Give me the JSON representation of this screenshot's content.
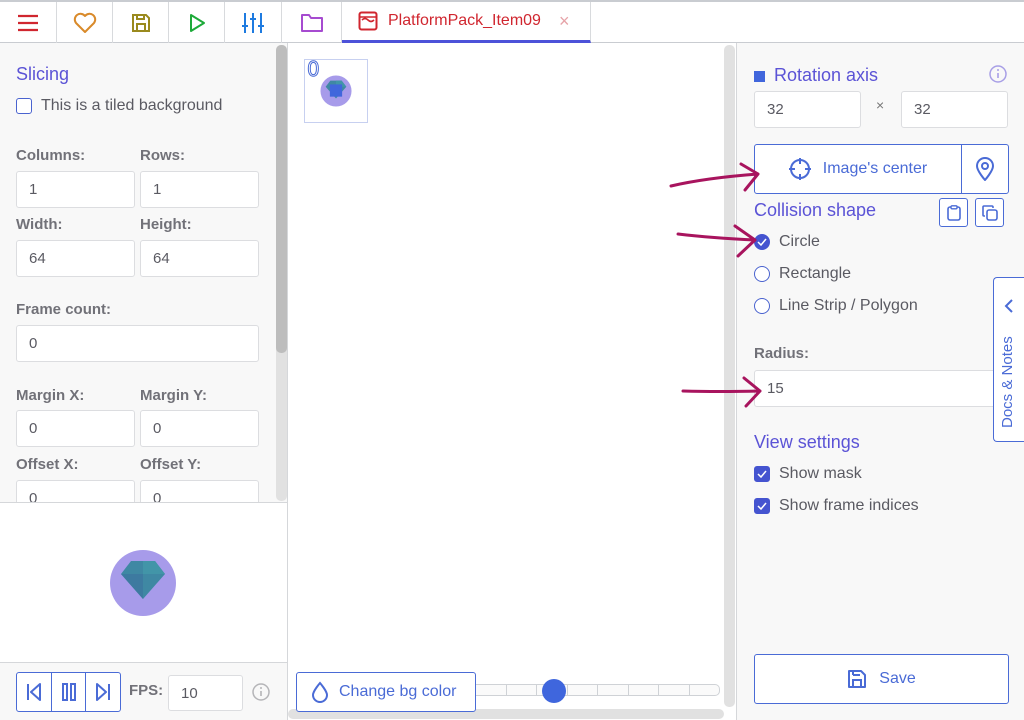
{
  "toolbar": {
    "buttons": [
      {
        "name": "menu",
        "icon": "hamburger-icon",
        "color": "#d0262f"
      },
      {
        "name": "favorites",
        "icon": "heart-icon",
        "color": "#d98a2a"
      },
      {
        "name": "save-project",
        "icon": "floppy-disk-icon",
        "color": "#9a8a1e"
      },
      {
        "name": "launch",
        "icon": "play-icon",
        "color": "#1eaa3a"
      },
      {
        "name": "settings",
        "icon": "sliders-icon",
        "color": "#1e7be0"
      },
      {
        "name": "assets",
        "icon": "folder-icon",
        "color": "#a64bd0"
      }
    ],
    "active_tab": {
      "label": "PlatformPack_Item09",
      "icon": "texture-icon",
      "close": "×"
    }
  },
  "left_panel": {
    "slicing_title": "Slicing",
    "tiled_checkbox": {
      "label": "This is a tiled background",
      "checked": false
    },
    "columns": {
      "label": "Columns:",
      "value": "1"
    },
    "rows": {
      "label": "Rows:",
      "value": "1"
    },
    "width": {
      "label": "Width:",
      "value": "64"
    },
    "height": {
      "label": "Height:",
      "value": "64"
    },
    "frame_count": {
      "label": "Frame count:",
      "value": "0"
    },
    "margin_x": {
      "label": "Margin X:",
      "value": "0"
    },
    "margin_y": {
      "label": "Margin Y:",
      "value": "0"
    },
    "offset_x": {
      "label": "Offset X:",
      "value": "0"
    },
    "offset_y": {
      "label": "Offset Y:",
      "value": "0"
    },
    "playback": {
      "first_frame": "skip-back-icon",
      "pause": "pause-icon",
      "last_frame": "skip-forward-icon",
      "fps_label": "FPS:",
      "fps_value": "10",
      "info": "info-icon"
    }
  },
  "canvas": {
    "frame_index": "0",
    "change_bg_label": "Change bg color",
    "zoom_slider_position": 0.25
  },
  "right_panel": {
    "rotation_axis_title": "Rotation axis",
    "axis_x": "32",
    "axis_sep": "×",
    "axis_y": "32",
    "image_center_label": "Image's center",
    "collision_title": "Collision shape",
    "shapes": [
      {
        "label": "Circle",
        "selected": true
      },
      {
        "label": "Rectangle",
        "selected": false
      },
      {
        "label": "Line Strip / Polygon",
        "selected": false
      }
    ],
    "radius_label": "Radius:",
    "radius_value": "15",
    "view_title": "View settings",
    "show_mask": {
      "label": "Show mask",
      "checked": true
    },
    "show_indices": {
      "label": "Show frame indices",
      "checked": true
    },
    "save_label": "Save",
    "docs_label": "Docs & Notes"
  },
  "colors": {
    "accent": "#4a6bd6",
    "title": "#5b53d6",
    "tab_text": "#d0262f",
    "annotation_arrow": "#a8145e"
  }
}
